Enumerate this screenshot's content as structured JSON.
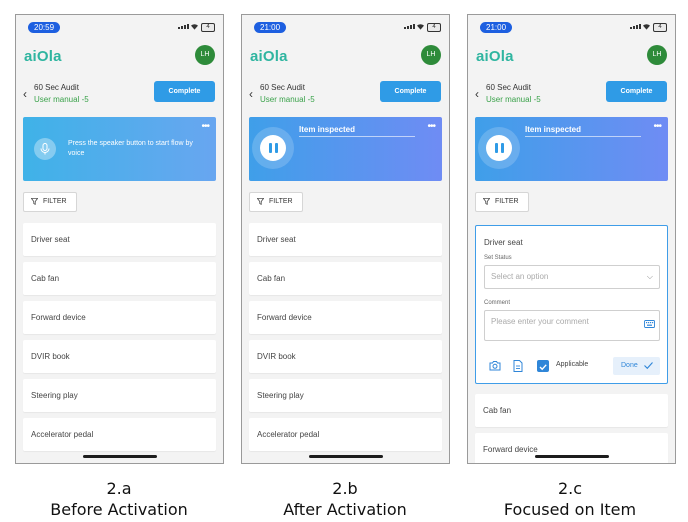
{
  "screens": [
    {
      "status": {
        "time": "20:59",
        "battery": "4"
      },
      "header": {
        "logo": "aiOla",
        "avatar": "LH"
      },
      "audit": {
        "title": "60 Sec Audit",
        "subtitle": "User manual -5",
        "complete_label": "Complete"
      },
      "voice": {
        "prompt": "Press the speaker button to start flow by voice"
      },
      "filter_label": "FILTER",
      "items": [
        "Driver seat",
        "Cab fan",
        "Forward device",
        "DVIR book",
        "Steering play",
        "Accelerator pedal"
      ],
      "caption": {
        "id": "2.a",
        "label": "Before Activation"
      }
    },
    {
      "status": {
        "time": "21:00",
        "battery": "4"
      },
      "header": {
        "logo": "aiOla",
        "avatar": "LH"
      },
      "audit": {
        "title": "60 Sec Audit",
        "subtitle": "User manual -5",
        "complete_label": "Complete"
      },
      "voice": {
        "heard": "Item inspected"
      },
      "filter_label": "FILTER",
      "items": [
        "Driver seat",
        "Cab fan",
        "Forward device",
        "DVIR book",
        "Steering play",
        "Accelerator pedal"
      ],
      "caption": {
        "id": "2.b",
        "label": "After Activation"
      }
    },
    {
      "status": {
        "time": "21:00",
        "battery": "4"
      },
      "header": {
        "logo": "aiOla",
        "avatar": "LH"
      },
      "audit": {
        "title": "60 Sec Audit",
        "subtitle": "User manual -5",
        "complete_label": "Complete"
      },
      "voice": {
        "heard": "Item inspected"
      },
      "filter_label": "FILTER",
      "focused": {
        "title": "Driver seat",
        "status_label": "Set Status",
        "status_placeholder": "Select an option",
        "comment_label": "Comment",
        "comment_placeholder": "Please enter your comment",
        "applicable_label": "Applicable",
        "applicable_checked": true,
        "done_label": "Done"
      },
      "items": [
        "Cab fan",
        "Forward device"
      ],
      "caption": {
        "id": "2.c",
        "label": "Focused on Item"
      }
    }
  ],
  "colors": {
    "accent": "#2f9be6",
    "brand_green": "#2fb5a0",
    "subtitle_green": "#3aa24a",
    "avatar_green": "#2e8b3a"
  }
}
